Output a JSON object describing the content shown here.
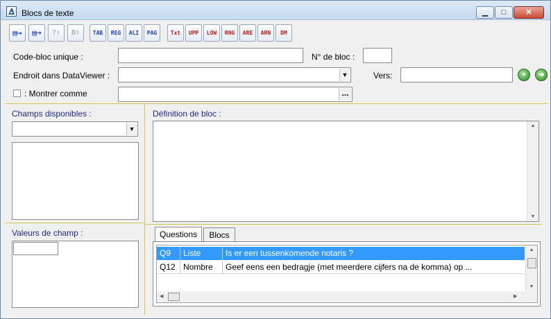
{
  "window": {
    "title": "Blocs de texte",
    "controls": {
      "minimize": "▁",
      "maximize": "□",
      "close": "✕"
    }
  },
  "toolbar": {
    "buttons": [
      {
        "id": "insert",
        "label": "▤→"
      },
      {
        "id": "add",
        "label": "▤➜"
      },
      {
        "id": "up",
        "label": "?↑"
      },
      {
        "id": "down",
        "label": "B↑"
      },
      {
        "id": "tab",
        "label": "TAB"
      },
      {
        "id": "reg",
        "label": "REG"
      },
      {
        "id": "ali",
        "label": "ALI"
      },
      {
        "id": "pag",
        "label": "PAG"
      },
      {
        "id": "txt",
        "label": "Txt"
      },
      {
        "id": "upp",
        "label": "UPP"
      },
      {
        "id": "low",
        "label": "LOW"
      },
      {
        "id": "rng",
        "label": "RNG"
      },
      {
        "id": "are",
        "label": "ARE"
      },
      {
        "id": "arn",
        "label": "ARN"
      },
      {
        "id": "dm",
        "label": "DM"
      }
    ]
  },
  "form": {
    "code_bloc_label": "Code-bloc unique :",
    "code_bloc_value": "",
    "num_bloc_label": "N° de bloc :",
    "num_bloc_value": "",
    "endroit_label": "Endroit dans DataViewer :",
    "endroit_value": "",
    "vers_label": "Vers:",
    "vers_value": "",
    "montrer_label": ": Montrer comme",
    "montrer_value": "",
    "ellipsis": "..."
  },
  "left": {
    "champs_label": "Champs disponibles :",
    "champs_value": "",
    "valeurs_label": "Valeurs de champ :"
  },
  "right": {
    "definition_label": "Définition de bloc :",
    "tabs": [
      "Questions",
      "Blocs"
    ],
    "rows": [
      {
        "code": "Q9",
        "type": "Liste",
        "text": "Is er een tussenkomende notaris ?",
        "selected": true
      },
      {
        "code": "Q12",
        "type": "Nombre",
        "text": "Geef eens een bedragje (met meerdere cijfers na de komma) op ...",
        "selected": false
      }
    ]
  },
  "colors": {
    "splitter": "#d6c24a",
    "selection": "#3399ff",
    "label_blue": "#1a2a8a"
  }
}
